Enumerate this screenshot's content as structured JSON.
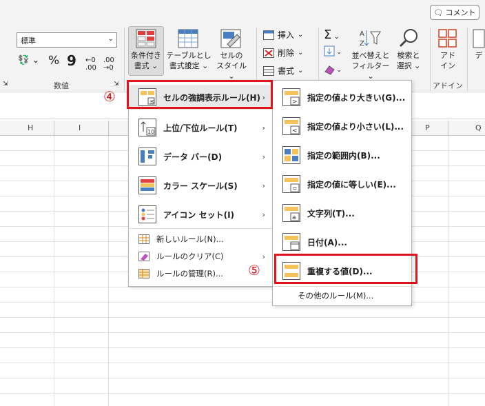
{
  "topbar": {
    "comment_label": "コメント",
    "comment_icon": "speech-bubble-icon"
  },
  "ribbon": {
    "number_format_value": "標準",
    "percent_symbol": "%",
    "comma_symbol": "9",
    "group_number_label": "数値",
    "conditional_format_label": "条件付き",
    "conditional_format_label2": "書式",
    "table_format_label": "テーブルとして",
    "table_format_label2": "書式設定",
    "cell_style_label": "セルの",
    "cell_style_label2": "スタイル",
    "insert_label": "挿入",
    "delete_label": "削除",
    "format_label": "書式",
    "sort_filter_label": "並べ替えと",
    "sort_filter_label2": "フィルター",
    "find_select_label": "検索と",
    "find_select_label2": "選択",
    "addin_label": "アド",
    "addin_label2": "イン",
    "addin_group_label": "アドイン",
    "sum_symbol": "Σ",
    "partial_label": "デ"
  },
  "sheet": {
    "columns": [
      "H",
      "I",
      "P",
      "Q"
    ]
  },
  "menu_main": {
    "items": [
      {
        "label": "セルの強調表示ルール(H)",
        "icon": "highlight-cells-icon",
        "has_submenu": true
      },
      {
        "label": "上位/下位ルール(T)",
        "icon": "top-bottom-icon",
        "has_submenu": true
      },
      {
        "label": "データ バー(D)",
        "icon": "data-bar-icon",
        "has_submenu": true
      },
      {
        "label": "カラー スケール(S)",
        "icon": "color-scale-icon",
        "has_submenu": true
      },
      {
        "label": "アイコン セット(I)",
        "icon": "icon-set-icon",
        "has_submenu": true
      }
    ],
    "small_items": [
      {
        "label": "新しいルール(N)...",
        "icon": "new-rule-icon"
      },
      {
        "label": "ルールのクリア(C)",
        "icon": "clear-rule-icon"
      },
      {
        "label": "ルールの管理(R)...",
        "icon": "manage-rule-icon"
      }
    ],
    "top10_text": "10"
  },
  "menu_sub": {
    "items": [
      {
        "label": "指定の値より大きい(G)...",
        "icon": "greater-than-icon"
      },
      {
        "label": "指定の値より小さい(L)...",
        "icon": "less-than-icon"
      },
      {
        "label": "指定の範囲内(B)...",
        "icon": "between-icon"
      },
      {
        "label": "指定の値に等しい(E)...",
        "icon": "equal-to-icon"
      },
      {
        "label": "文字列(T)...",
        "icon": "text-contains-icon"
      },
      {
        "label": "日付(A)...",
        "icon": "date-occurring-icon"
      },
      {
        "label": "重複する値(D)...",
        "icon": "duplicate-values-icon"
      }
    ],
    "more_rules": "その他のルール(M)..."
  },
  "annotations": {
    "step4": "④",
    "step5": "⑤"
  },
  "colors": {
    "highlight_red": "#e0131b",
    "ribbon_bg": "#f3f3f3"
  }
}
